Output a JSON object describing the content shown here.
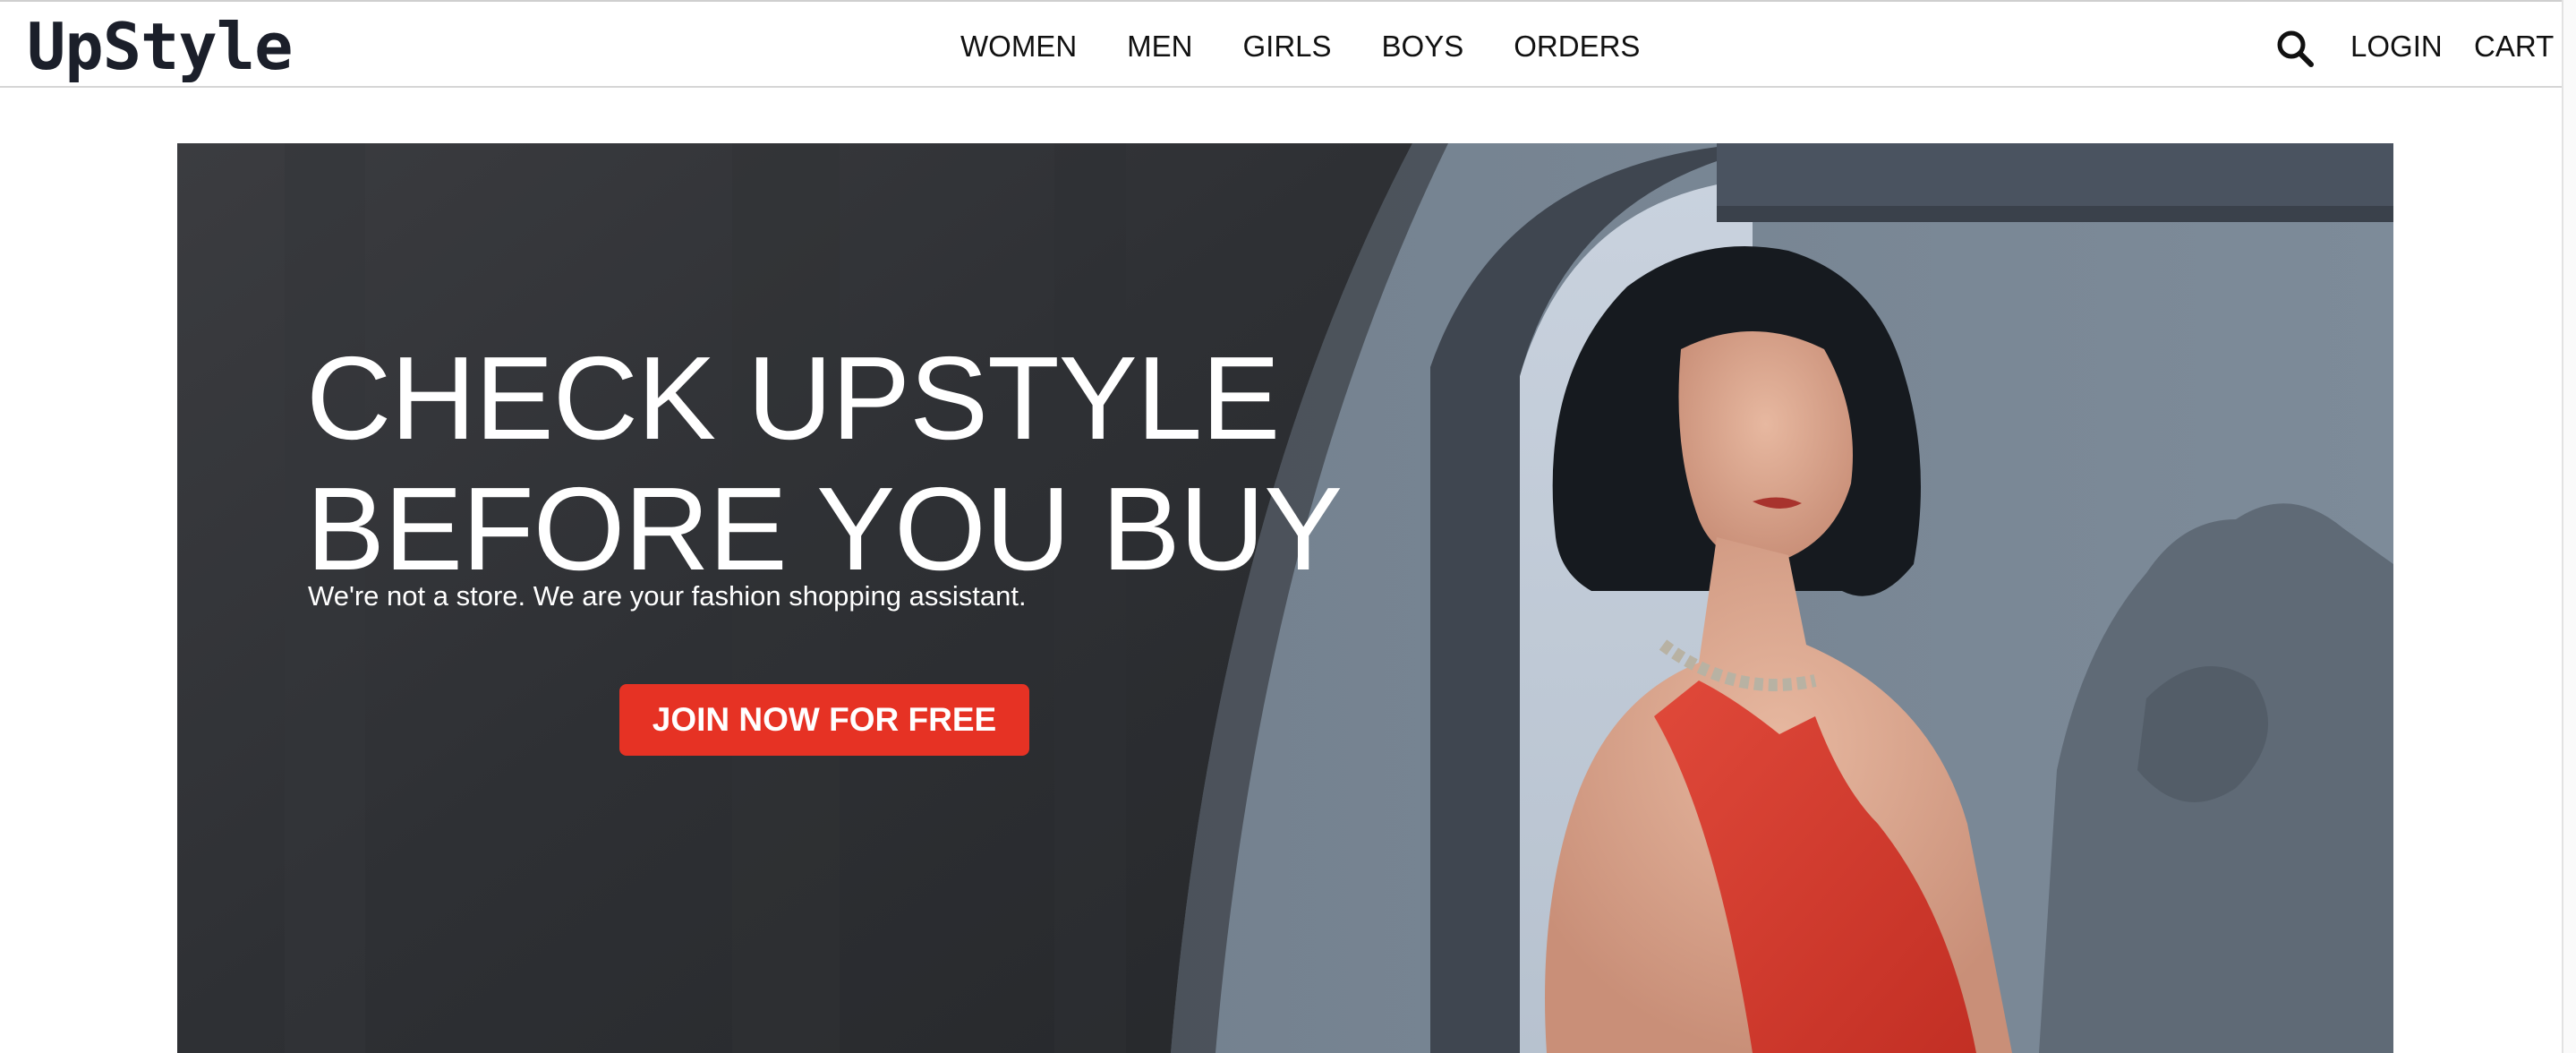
{
  "brand": {
    "logo_text": "UpStyle"
  },
  "nav": {
    "items": [
      {
        "label": "WOMEN"
      },
      {
        "label": "MEN"
      },
      {
        "label": "GIRLS"
      },
      {
        "label": "BOYS"
      },
      {
        "label": "ORDERS"
      }
    ],
    "search_icon": "search-icon",
    "login_label": "LOGIN",
    "cart_label": "CART"
  },
  "hero": {
    "title_line1": "CHECK UPSTYLE",
    "title_line2": "BEFORE YOU BUY",
    "subtitle": "We're not a store. We are your fashion shopping assistant.",
    "cta_label": "JOIN NOW FOR FREE"
  },
  "colors": {
    "accent": "#e63224",
    "text_dark": "#111111",
    "logo": "#1b1f2a",
    "hero_overlay": "#2c2e33"
  }
}
